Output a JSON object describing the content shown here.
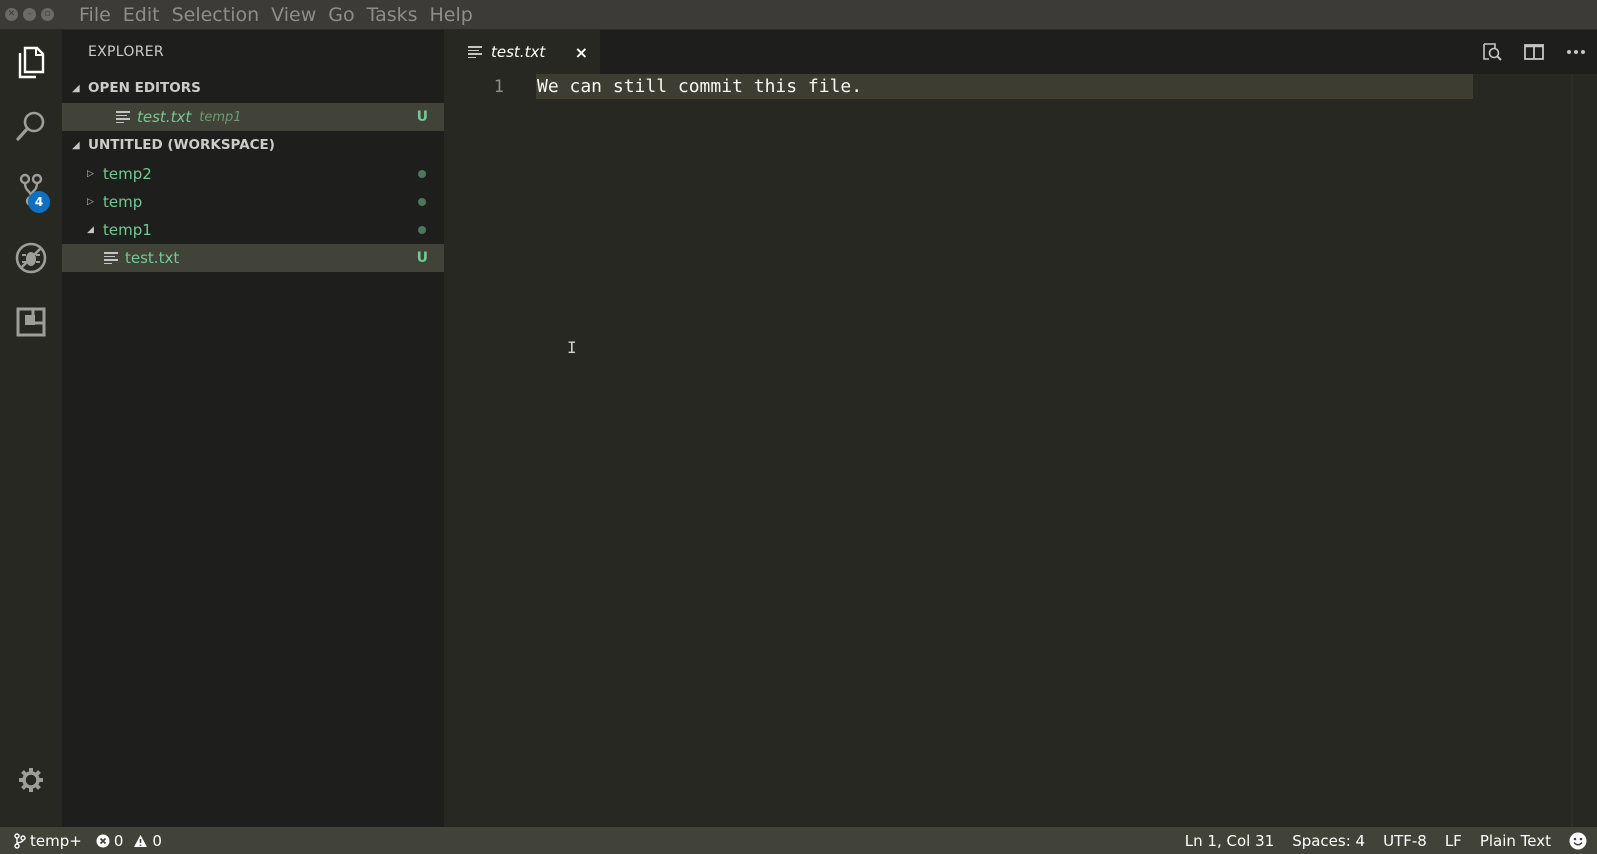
{
  "menu": [
    "File",
    "Edit",
    "Selection",
    "View",
    "Go",
    "Tasks",
    "Help"
  ],
  "window_buttons": [
    "close",
    "minimize",
    "maximize"
  ],
  "activity_bar": {
    "items": [
      {
        "name": "explorer-icon"
      },
      {
        "name": "search-icon"
      },
      {
        "name": "source-control-icon",
        "badge": "4"
      },
      {
        "name": "debug-icon"
      },
      {
        "name": "extensions-icon"
      }
    ],
    "settings": "gear-icon"
  },
  "sidebar": {
    "title": "EXPLORER",
    "open_editors": {
      "heading": "OPEN EDITORS",
      "items": [
        {
          "file": "test.txt",
          "folder": "temp1",
          "status": "U"
        }
      ]
    },
    "workspace": {
      "heading": "UNTITLED (WORKSPACE)",
      "folders": [
        {
          "name": "temp2",
          "expanded": false
        },
        {
          "name": "temp",
          "expanded": false
        },
        {
          "name": "temp1",
          "expanded": true
        }
      ],
      "files": [
        {
          "name": "test.txt",
          "status": "U"
        }
      ]
    }
  },
  "tabs": [
    {
      "label": "test.txt",
      "close": "×",
      "active": true
    }
  ],
  "editor": {
    "lines": [
      {
        "number": "1",
        "text": "We can still commit this file."
      }
    ]
  },
  "statusbar": {
    "branch": "temp+",
    "errors": "0",
    "warnings": "0",
    "position": "Ln 1, Col 31",
    "spaces": "Spaces: 4",
    "encoding": "UTF-8",
    "eol": "LF",
    "language": "Plain Text"
  },
  "colors": {
    "accent_green": "#73c991",
    "badge_blue": "#0e70c0",
    "status_bar": "#414339"
  }
}
